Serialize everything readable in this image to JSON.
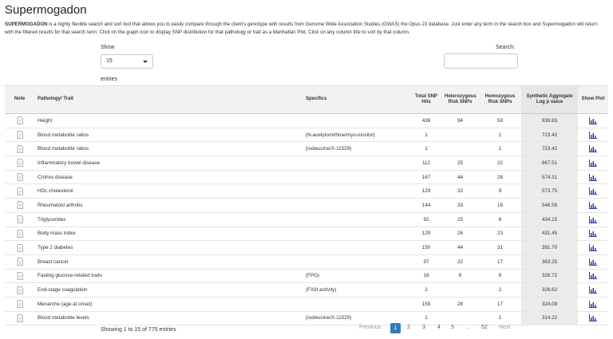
{
  "page": {
    "title": "Supermogadon",
    "intro_bold": "SUPERMOGADON",
    "intro_text": " is a highly flexible search and sort tool that allows you to easily compare through the client's genotype with results from Genome Wide Association Studies (GWAS) the Opus 23 database. Just enter any term in the search box and Supermogadon will return with the filtered results for that search term. Click on the graph icon to display SNP distribution for that pathology or trait as a Manhattan Plot. Click on any column title to sort by that column."
  },
  "controls": {
    "show_label": "Show",
    "show_value": "15",
    "entries_label": "entries",
    "search_label": "Search:",
    "search_value": ""
  },
  "table": {
    "headers": {
      "note": "Note",
      "trait": "Pathology/ Trait",
      "specifics": "Specifics",
      "total": "Total SNP Hits",
      "hetero": "Heterozygous Risk SNPs",
      "homo": "Homozygous Risk SNPs",
      "sag": "Synthetic Aggregate Log p value",
      "plot": "Show Plot"
    },
    "rows": [
      {
        "trait": "Height",
        "specifics": "",
        "total": "436",
        "hetero": "94",
        "homo": "59",
        "sag": "939.83"
      },
      {
        "trait": "Blood metabolite ratios",
        "specifics": "(N-acetylornithine/myo-inositol)",
        "total": "1",
        "hetero": "",
        "homo": "1",
        "sag": "723.42"
      },
      {
        "trait": "Blood metabolite ratios",
        "specifics": "(isoleucine/X-11529)",
        "total": "1",
        "hetero": "",
        "homo": "1",
        "sag": "723.42"
      },
      {
        "trait": "Inflammatory bowel disease",
        "specifics": "",
        "total": "112",
        "hetero": "25",
        "homo": "22",
        "sag": "667.51"
      },
      {
        "trait": "Crohns disease",
        "specifics": "",
        "total": "167",
        "hetero": "44",
        "homo": "28",
        "sag": "574.31"
      },
      {
        "trait": "HDL cholesterol",
        "specifics": "",
        "total": "129",
        "hetero": "32",
        "homo": "9",
        "sag": "573.75"
      },
      {
        "trait": "Rheumatoid arthritis",
        "specifics": "",
        "total": "144",
        "hetero": "33",
        "homo": "16",
        "sag": "546.58"
      },
      {
        "trait": "Triglycerides",
        "specifics": "",
        "total": "92",
        "hetero": "25",
        "homo": "6",
        "sag": "434.15"
      },
      {
        "trait": "Body mass index",
        "specifics": "",
        "total": "129",
        "hetero": "26",
        "homo": "23",
        "sag": "431.45"
      },
      {
        "trait": "Type 2 diabetes",
        "specifics": "",
        "total": "150",
        "hetero": "44",
        "homo": "31",
        "sag": "391.70"
      },
      {
        "trait": "Breast cancer",
        "specifics": "",
        "total": "97",
        "hetero": "32",
        "homo": "17",
        "sag": "363.25"
      },
      {
        "trait": "Fasting glucose-related traits",
        "specifics": "(FPG)",
        "total": "16",
        "hetero": "6",
        "homo": "6",
        "sag": "326.72"
      },
      {
        "trait": "End-stage coagulation",
        "specifics": "(FXIII activity)",
        "total": "2",
        "hetero": "",
        "homo": "2",
        "sag": "326.62"
      },
      {
        "trait": "Menarche (age at onset)",
        "specifics": "",
        "total": "159",
        "hetero": "28",
        "homo": "17",
        "sag": "324.08"
      },
      {
        "trait": "Blood metabolite levels",
        "specifics": "(isoleucine/X-11529)",
        "total": "1",
        "hetero": "",
        "homo": "1",
        "sag": "314.22"
      }
    ]
  },
  "pagination": {
    "info": "Showing 1 to 15 of 775 entries",
    "previous": "Previous",
    "pages": [
      "1",
      "2",
      "3",
      "4",
      "5"
    ],
    "ellipsis": "...",
    "last": "52",
    "next": "Next",
    "active_page": "1",
    "active_color": "#337ab7"
  },
  "icons": {
    "note": "note-page-icon",
    "plot": "bar-chart-icon",
    "plot_color": "#2f3fa8"
  }
}
